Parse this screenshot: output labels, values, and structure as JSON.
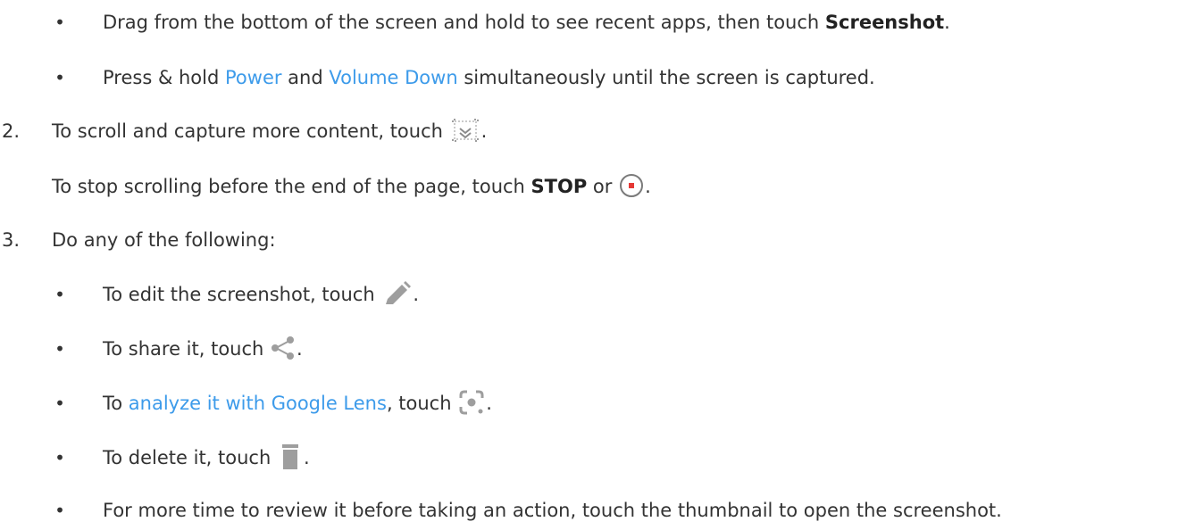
{
  "bullets_top": [
    {
      "pre": "Drag from the bottom of the screen and hold to see recent apps, then touch ",
      "bold": "Screenshot",
      "post": "."
    },
    {
      "pre": "Press & hold ",
      "link1": "Power",
      "mid": " and ",
      "link2": "Volume Down",
      "post": " simultaneously until the screen is captured."
    }
  ],
  "step2": {
    "number": "2.",
    "text": "To scroll and capture more content, touch ",
    "text_end": ".",
    "icon": "scroll-capture-icon",
    "sub_pre": "To stop scrolling before the end of the page, touch ",
    "sub_bold": "STOP",
    "sub_mid": " or ",
    "sub_icon": "stop-record-icon",
    "sub_end": "."
  },
  "step3": {
    "number": "3.",
    "text": "Do any of the following:",
    "items": [
      {
        "pre": "To edit the screenshot, touch ",
        "icon": "pencil-icon",
        "post": "."
      },
      {
        "pre": "To share it, touch ",
        "icon": "share-icon",
        "post": "."
      },
      {
        "pre": "To ",
        "link": "analyze it with Google Lens",
        "mid": ", touch ",
        "icon": "lens-icon",
        "post": "."
      },
      {
        "pre": "To delete it, touch ",
        "icon": "trash-icon",
        "post": "."
      },
      {
        "pre": "For more time to review it before taking an action, touch the thumbnail to open the screenshot."
      }
    ]
  },
  "colors": {
    "text": "#333333",
    "link": "#3d9bea",
    "icon": "#9e9e9e",
    "stop_red": "#e53935"
  }
}
